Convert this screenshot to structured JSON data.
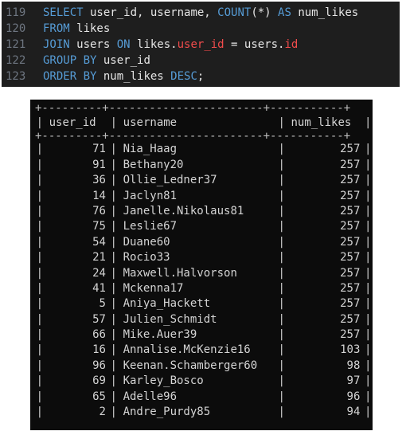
{
  "editor": {
    "lines": [
      {
        "num": "119",
        "tokens": [
          {
            "t": "SELECT",
            "c": "kw"
          },
          {
            "t": " user_id, username, ",
            "c": ""
          },
          {
            "t": "COUNT",
            "c": "fn"
          },
          {
            "t": "(*) ",
            "c": ""
          },
          {
            "t": "AS",
            "c": "kw"
          },
          {
            "t": " num_likes",
            "c": ""
          }
        ]
      },
      {
        "num": "120",
        "tokens": [
          {
            "t": "FROM",
            "c": "kw"
          },
          {
            "t": " likes",
            "c": ""
          }
        ]
      },
      {
        "num": "121",
        "tokens": [
          {
            "t": "JOIN",
            "c": "kw"
          },
          {
            "t": " users ",
            "c": ""
          },
          {
            "t": "ON",
            "c": "kw"
          },
          {
            "t": " likes.",
            "c": ""
          },
          {
            "t": "user_id",
            "c": "col"
          },
          {
            "t": " = users.",
            "c": ""
          },
          {
            "t": "id",
            "c": "col"
          }
        ]
      },
      {
        "num": "122",
        "tokens": [
          {
            "t": "GROUP BY",
            "c": "kw"
          },
          {
            "t": " user_id",
            "c": ""
          }
        ]
      },
      {
        "num": "123",
        "tokens": [
          {
            "t": "ORDER BY",
            "c": "kw"
          },
          {
            "t": " num_likes ",
            "c": ""
          },
          {
            "t": "DESC",
            "c": "kw"
          },
          {
            "t": ";",
            "c": ""
          }
        ]
      }
    ]
  },
  "result": {
    "border": "+---------+-----------------------+-----------+",
    "headers": [
      "user_id",
      "username",
      "num_likes"
    ],
    "rows": [
      [
        "71",
        "Nia_Haag",
        "257"
      ],
      [
        "91",
        "Bethany20",
        "257"
      ],
      [
        "36",
        "Ollie_Ledner37",
        "257"
      ],
      [
        "14",
        "Jaclyn81",
        "257"
      ],
      [
        "76",
        "Janelle.Nikolaus81",
        "257"
      ],
      [
        "75",
        "Leslie67",
        "257"
      ],
      [
        "54",
        "Duane60",
        "257"
      ],
      [
        "21",
        "Rocio33",
        "257"
      ],
      [
        "24",
        "Maxwell.Halvorson",
        "257"
      ],
      [
        "41",
        "Mckenna17",
        "257"
      ],
      [
        "5",
        "Aniya_Hackett",
        "257"
      ],
      [
        "57",
        "Julien_Schmidt",
        "257"
      ],
      [
        "66",
        "Mike.Auer39",
        "257"
      ],
      [
        "16",
        "Annalise.McKenzie16",
        "103"
      ],
      [
        "96",
        "Keenan.Schamberger60",
        "98"
      ],
      [
        "69",
        "Karley_Bosco",
        "97"
      ],
      [
        "65",
        "Adelle96",
        "96"
      ],
      [
        "2",
        "Andre_Purdy85",
        "94"
      ]
    ]
  }
}
